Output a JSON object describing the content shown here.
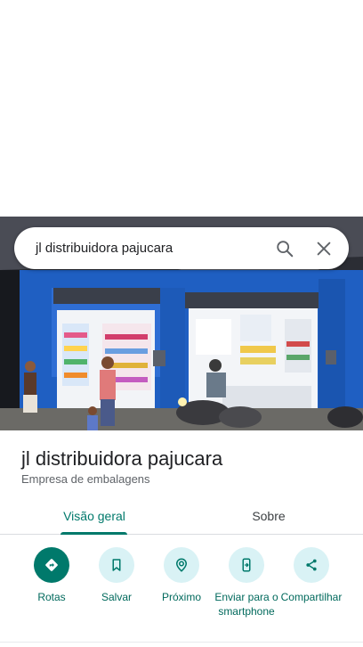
{
  "search": {
    "query": "jl distribuidora pajucara",
    "search_icon": "search-icon",
    "close_icon": "close-icon"
  },
  "place": {
    "name": "jl distribuidora pajucara",
    "category": "Empresa de embalagens"
  },
  "tabs": [
    {
      "label": "Visão geral",
      "selected": true
    },
    {
      "label": "Sobre",
      "selected": false
    }
  ],
  "actions": [
    {
      "label": "Rotas",
      "icon": "directions-icon"
    },
    {
      "label": "Salvar",
      "icon": "bookmark-icon"
    },
    {
      "label": "Próximo",
      "icon": "nearby-icon"
    },
    {
      "label": "Enviar para o smartphone",
      "icon": "send-to-phone-icon"
    },
    {
      "label": "Compartilhar",
      "icon": "share-icon"
    }
  ],
  "colors": {
    "accent": "#00796b",
    "action_bg": "#d9f2f5",
    "storefront_blue": "#1f6fd6"
  }
}
